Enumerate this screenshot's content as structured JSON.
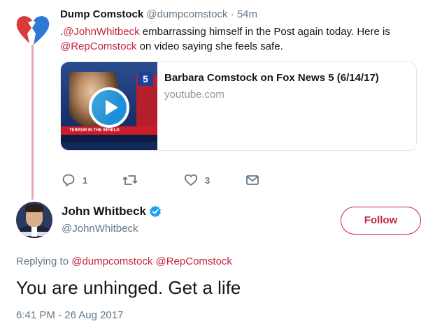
{
  "parent_tweet": {
    "name": "Dump Comstock",
    "handle": "@dumpcomstock",
    "separator": "·",
    "time": "54m",
    "text_prefix": ".",
    "mention1": "@JohnWhitbeck",
    "text_middle": " embarrassing himself in the Post again today. Here is ",
    "mention2": "@RepComstock",
    "text_suffix": " on video saying she feels safe.",
    "avatar_icon": "broken-heart-icon",
    "card": {
      "title": "Barbara Comstock on Fox News 5 (6/14/17)",
      "domain": "youtube.com",
      "thumb_logo": "5",
      "thumb_banner": "TERROR IN THE INFIELD",
      "play_icon": "play-icon"
    },
    "actions": {
      "reply_count": "1",
      "retweet_count": "",
      "like_count": "3"
    }
  },
  "main_tweet": {
    "name": "John Whitbeck",
    "handle": "@JohnWhitbeck",
    "follow_label": "Follow",
    "replying_prefix": "Replying to ",
    "replying_to_1": "@dumpcomstock",
    "replying_to_2": "@RepComstock",
    "text": "You are unhinged. Get a life",
    "timestamp": "6:41 PM - 26 Aug 2017"
  },
  "colors": {
    "accent": "#c5263d",
    "secondary_text": "#657786",
    "thread_line": "#e8a7b0",
    "verified": "#1da1f2"
  }
}
